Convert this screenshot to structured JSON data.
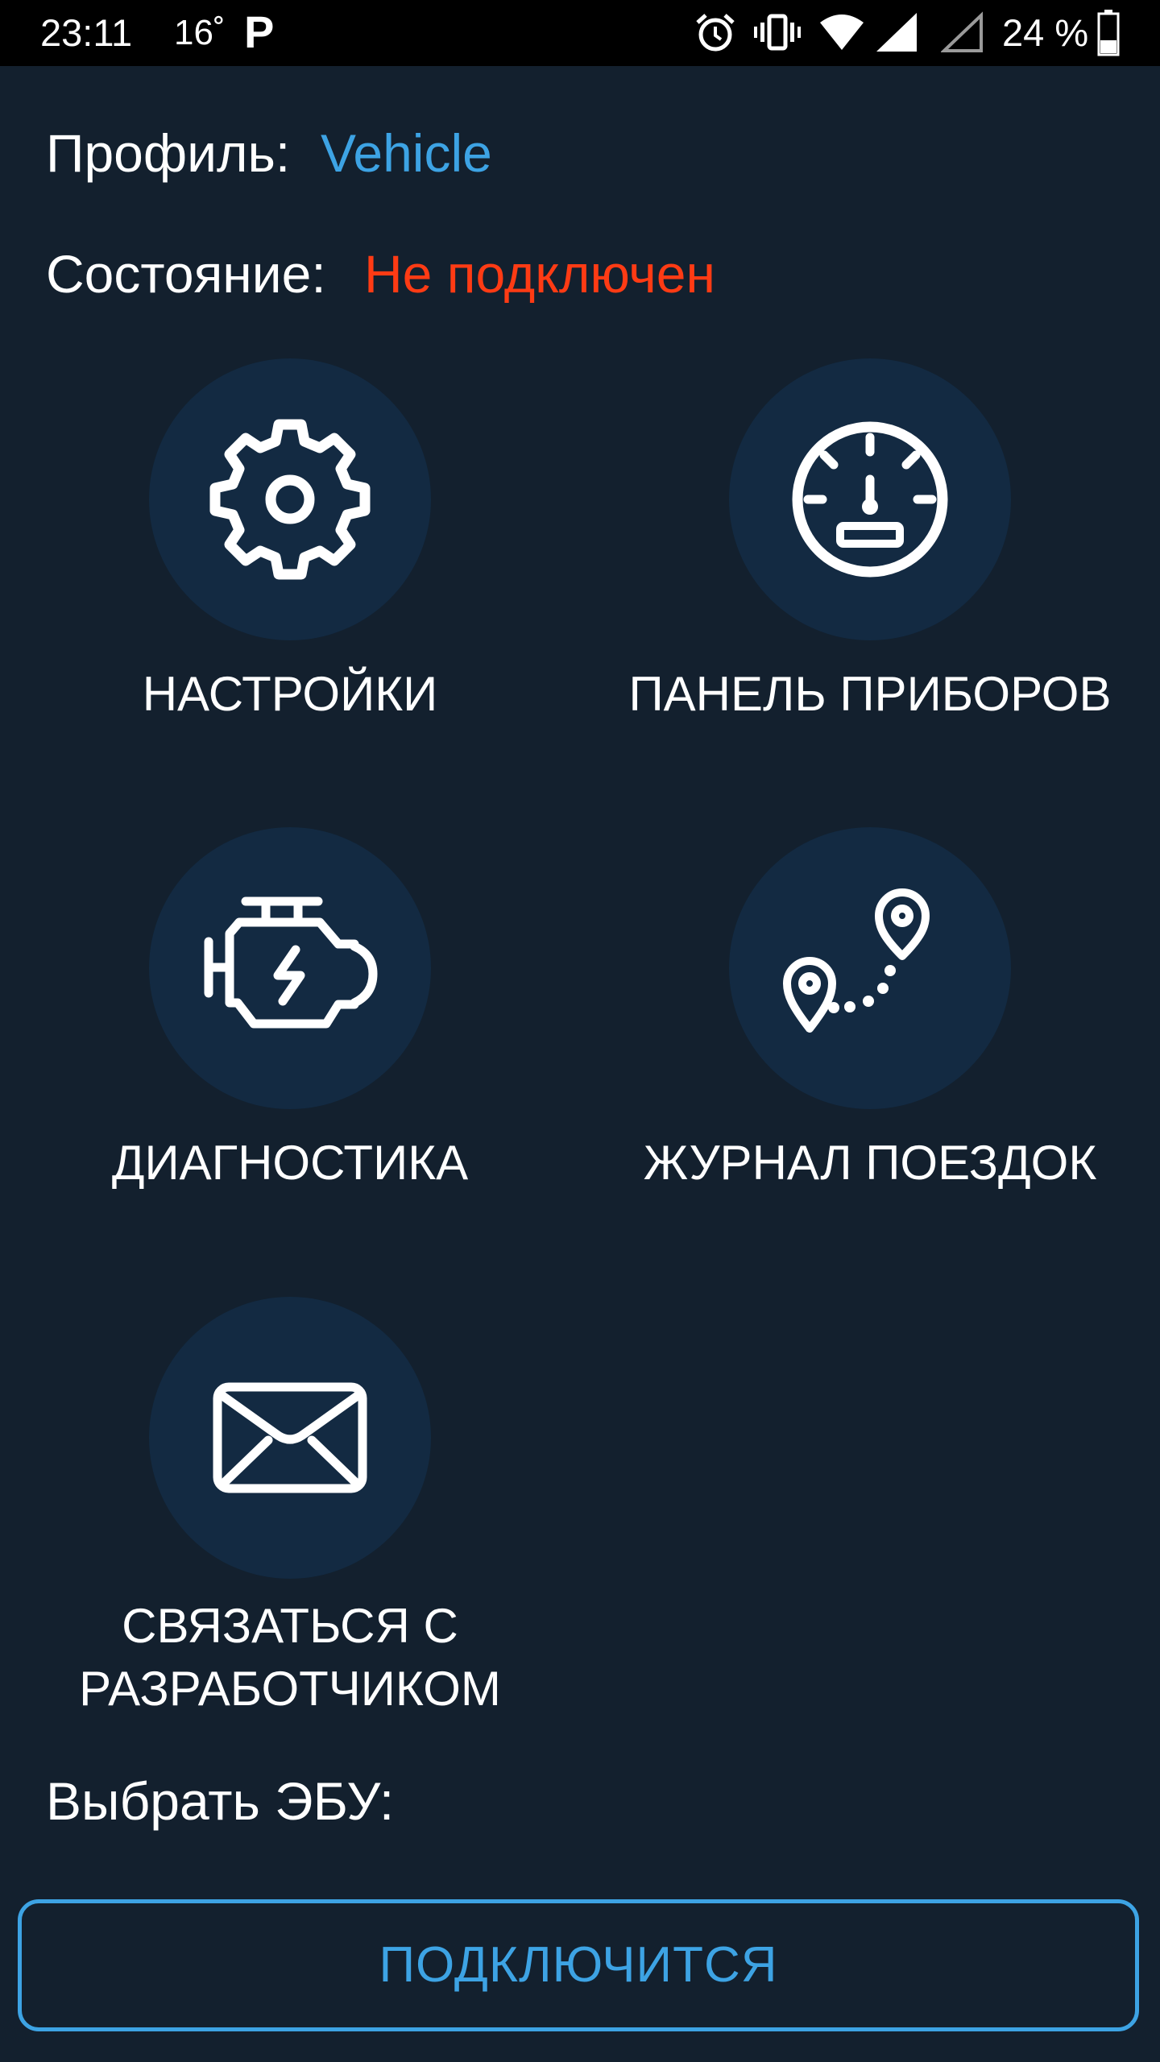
{
  "status_bar": {
    "time": "23:11",
    "temperature": "16˚",
    "notification_letter": "P",
    "battery_text": "24 %",
    "icons": [
      "alarm-icon",
      "vibrate-icon",
      "wifi-icon",
      "signal-full-icon",
      "signal-empty-icon",
      "battery-icon"
    ]
  },
  "profile": {
    "label": "Профиль:",
    "value": "Vehicle"
  },
  "status": {
    "label": "Состояние:",
    "value": "Не подключен"
  },
  "tiles": [
    {
      "label": "НАСТРОЙКИ",
      "icon": "gear-icon"
    },
    {
      "label": "ПАНЕЛЬ ПРИБОРОВ",
      "icon": "speedometer-icon"
    },
    {
      "label": "ДИАГНОСТИКА",
      "icon": "engine-icon"
    },
    {
      "label": "ЖУРНАЛ ПОЕЗДОК",
      "icon": "route-pins-icon"
    },
    {
      "label": "СВЯЗАТЬСЯ С\nРАЗРАБОТЧИКОМ",
      "icon": "envelope-icon"
    }
  ],
  "ecu": {
    "label": "Выбрать ЭБУ:"
  },
  "connect_button": {
    "label": "ПОДКЛЮЧИТСЯ"
  },
  "colors": {
    "background": "#13202e",
    "tile_circle": "#132a42",
    "accent": "#3da3e4",
    "error": "#ff3b14"
  }
}
